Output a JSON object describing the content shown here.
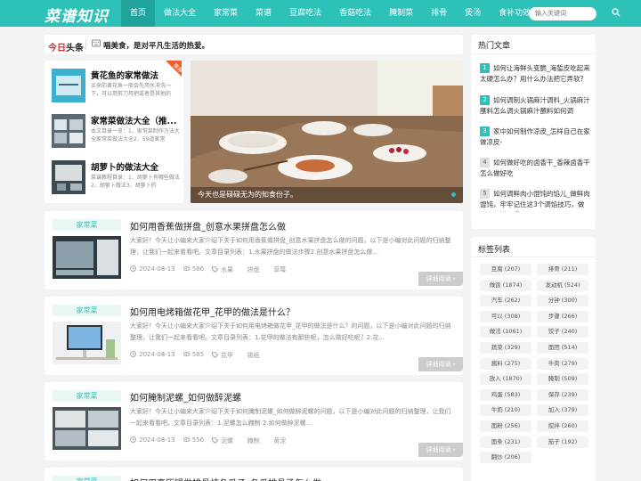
{
  "header": {
    "logo": "菜谱知识",
    "nav": [
      "首页",
      "做法大全",
      "家常菜",
      "菜谱",
      "豆腐吃法",
      "香菇吃法",
      "腌制菜",
      "排骨",
      "煲汤",
      "食补功效"
    ],
    "search_placeholder": "输入关键词"
  },
  "ticker": {
    "logo_red": "今日",
    "logo_black": "头条",
    "text": "唱美食，是对平凡生活的热爱。"
  },
  "featured": [
    {
      "title": "黄花鱼的家常做法",
      "desc": "买来的黄花鱼一般会先用水冲洗一下，可以用剪刀用把或者是其他的",
      "badge": "推荐"
    },
    {
      "title": "家常菜做法大全（推...",
      "desc": "本文目录一览：1、家常菜制作方法大全家常菜做法大全2、59道家常"
    },
    {
      "title": "胡萝卜的做法大全",
      "desc": "菜谱教程目录：1、胡萝卜有哪些做法 2、胡萝卜做法3、胡萝卜的"
    }
  ],
  "hero": {
    "caption": "今天也是碌碌无为的知食份子。"
  },
  "posts": [
    {
      "category": "家常菜",
      "title": "如何用香蕉做拼盘_创意水果拼盘怎么做",
      "desc": "大家好！今天让小编来大家介绍下关于如何用香蕉做拼盘_创意水果拼盘怎么做的问题，以下是小编对此问题的归纳整理，让我们一起来看看吧。文章目录列表：1.水果拼盘的做法步骤2.创意水果拼盘怎么做...",
      "date": "2024-08-13",
      "views": "586",
      "tags": [
        "水果",
        "拼盘",
        "草莓"
      ],
      "more": "详细阅读"
    },
    {
      "category": "家常菜",
      "title": "如何用电烤箱做花甲_花甲的做法是什么？",
      "desc": "大家好！今天让小编来大家介绍下关于如何用电烤箱做花甲_花甲的做法是什么？的问题，以下是小编对此问题的归纳整理，让我们一起来看看吧。文章目录列表：1.花甲的做法有那些呢，怎么做好吃呢？2.花...",
      "date": "2024-08-13",
      "views": "585",
      "tags": [
        "花甲",
        "锡纸"
      ],
      "more": "详细阅读"
    },
    {
      "category": "家常菜",
      "title": "如何腌制泥螺_如何做醉泥螺",
      "desc": "大家好！今天让小编来大家介绍下关于如何腌制泥螺_如何做醉泥螺的问题，以下是小编对此问题的归纳整理，让我们一起来看看吧。文章目录列表：1.泥螺怎么腌制 2.如何做醉泥螺...",
      "date": "2024-08-13",
      "views": "556",
      "tags": [
        "泥螺",
        "腌制",
        "黄泥"
      ],
      "more": "详细阅读"
    },
    {
      "category": "家常菜",
      "title": "如何用高压锅做排骨炖冬瓜子_冬瓜排骨汤怎么做"
    }
  ],
  "sidebar": {
    "hot_title": "热门文章",
    "hot": [
      "如何让海鲜头变脆_海蜇皮吃起来太硬怎么办？用什么办法把它弄软?",
      "如何调制火锅麻汁调料_火锅麻汁蘸料怎么调火锅麻汁蘸料如何调",
      "家中如何制作凉皮_怎样自己在家做凉皮-",
      "如何做好吃的卤香干_香辣卤香干怎么做好吃",
      "如何调鲜肉小馄饨的馅儿_做鲜肉馄饨，牢牢记住这3个调馅技巧，做出来又嫩又香，不用去买了"
    ],
    "tags_title": "标签列表",
    "tags": [
      [
        "豆腐 (207)",
        "排骨 (211)"
      ],
      [
        "做饭 (1874)",
        "发动机 (524)"
      ],
      [
        "汽车 (262)",
        "分钟 (300)"
      ],
      [
        "可以 (308)",
        "步骤 (266)"
      ],
      [
        "做法 (1061)",
        "饺子 (240)"
      ],
      [
        "蔬菜 (329)",
        "面团 (514)"
      ],
      [
        "酱料 (275)",
        "牛肉 (279)"
      ],
      [
        "放入 (1870)",
        "腌制 (509)"
      ],
      [
        "鸡蛋 (583)",
        "保存 (239)"
      ],
      [
        "牛奶 (210)",
        "加入 (379)"
      ],
      [
        "面粉 (256)",
        "搅拌 (260)"
      ],
      [
        "面条 (231)",
        "茄子 (192)"
      ],
      [
        "翻炒 (206)",
        ""
      ]
    ]
  },
  "colors": {
    "accent": "#2ec1b8",
    "accent_dark": "#20a39b",
    "badge": "#f25b2b"
  }
}
